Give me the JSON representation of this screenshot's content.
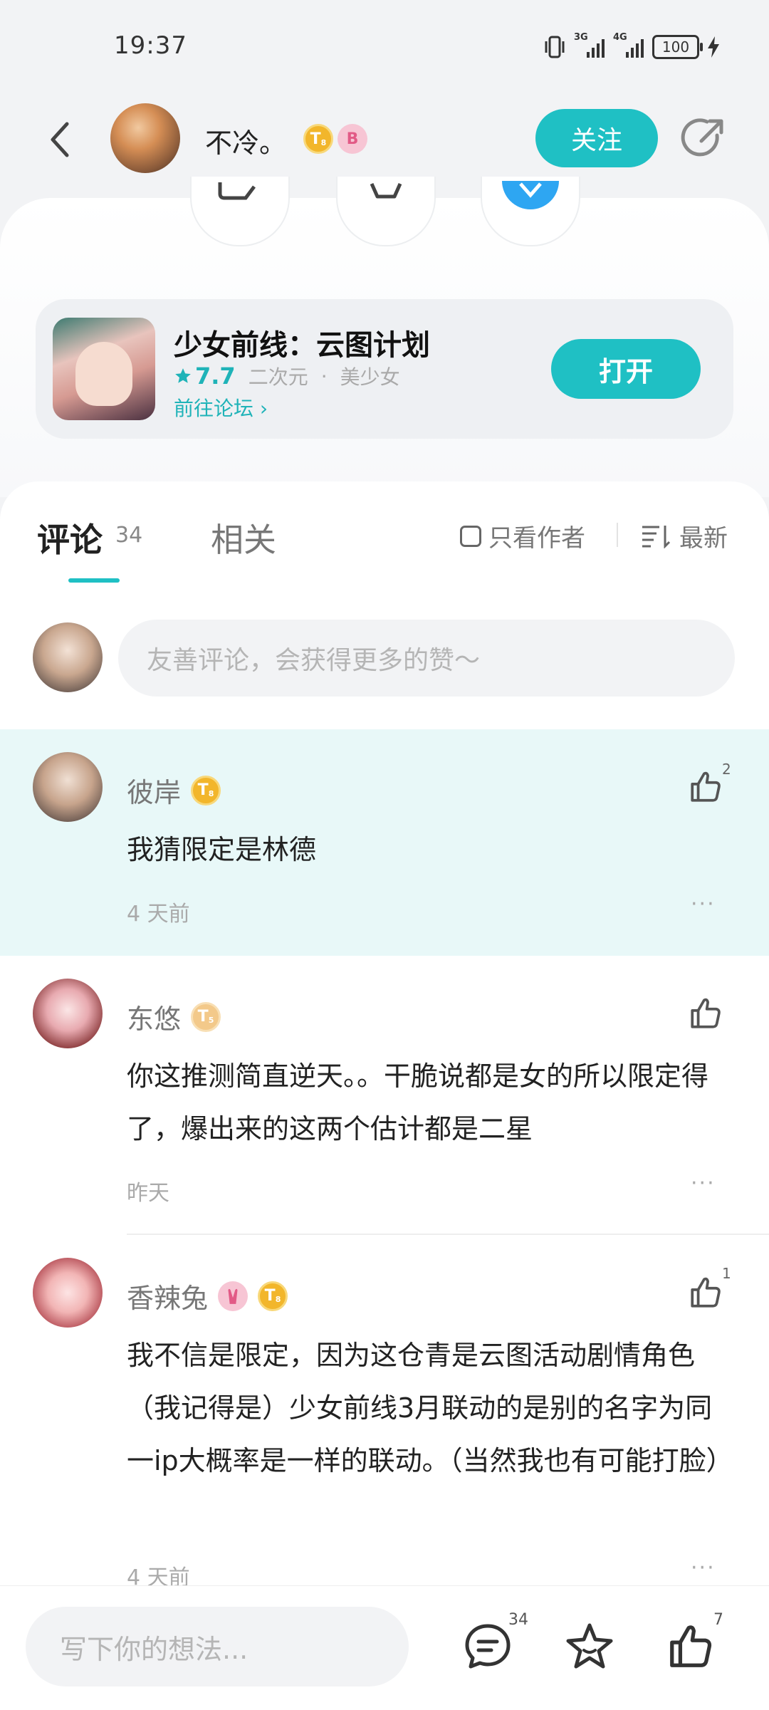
{
  "status_bar": {
    "time": "19:37",
    "signal1": "3G",
    "signal2": "4G",
    "battery": "100"
  },
  "header": {
    "author_name": "不冷。",
    "badge_t": "T",
    "badge_t_level": "8",
    "badge_pink": "B",
    "follow_label": "关注"
  },
  "game": {
    "title": "少女前线：云图计划",
    "rating": "7.7",
    "tag1": "二次元",
    "dot": "·",
    "tag2": "美少女",
    "forum_link": "前往论坛",
    "forum_chevron": "›",
    "open_label": "打开"
  },
  "tabs": {
    "comments_label": "评论",
    "comments_count": "34",
    "related_label": "相关",
    "only_author_label": "只看作者",
    "sort_label": "最新"
  },
  "composer": {
    "placeholder": "友善评论，会获得更多的赞～"
  },
  "comments": [
    {
      "name": "彼岸",
      "badge": "T",
      "badge_level": "8",
      "text": "我猜限定是林德",
      "time": "4 天前",
      "likes": "2",
      "more": "···"
    },
    {
      "name": "东悠",
      "badge": "T",
      "badge_level": "5",
      "text": "你这推测简直逆天。。干脆说都是女的所以限定得了，爆出来的这两个估计都是二星",
      "time": "昨天",
      "likes": "",
      "more": "···"
    },
    {
      "name": "香辣兔",
      "badge": "T",
      "badge_level": "8",
      "text": "我不信是限定，因为这仓青是云图活动剧情角色（我记得是）少女前线3月联动的是别的名字为同一ip大概率是一样的联动。（当然我也有可能打脸）",
      "time": "4 天前",
      "likes": "1",
      "more": "···"
    }
  ],
  "bottom_bar": {
    "placeholder": "写下你的想法...",
    "comment_count": "34",
    "like_count": "7"
  },
  "colors": {
    "accent": "#1fc0c4",
    "highlight_row": "#e8f8f8"
  }
}
